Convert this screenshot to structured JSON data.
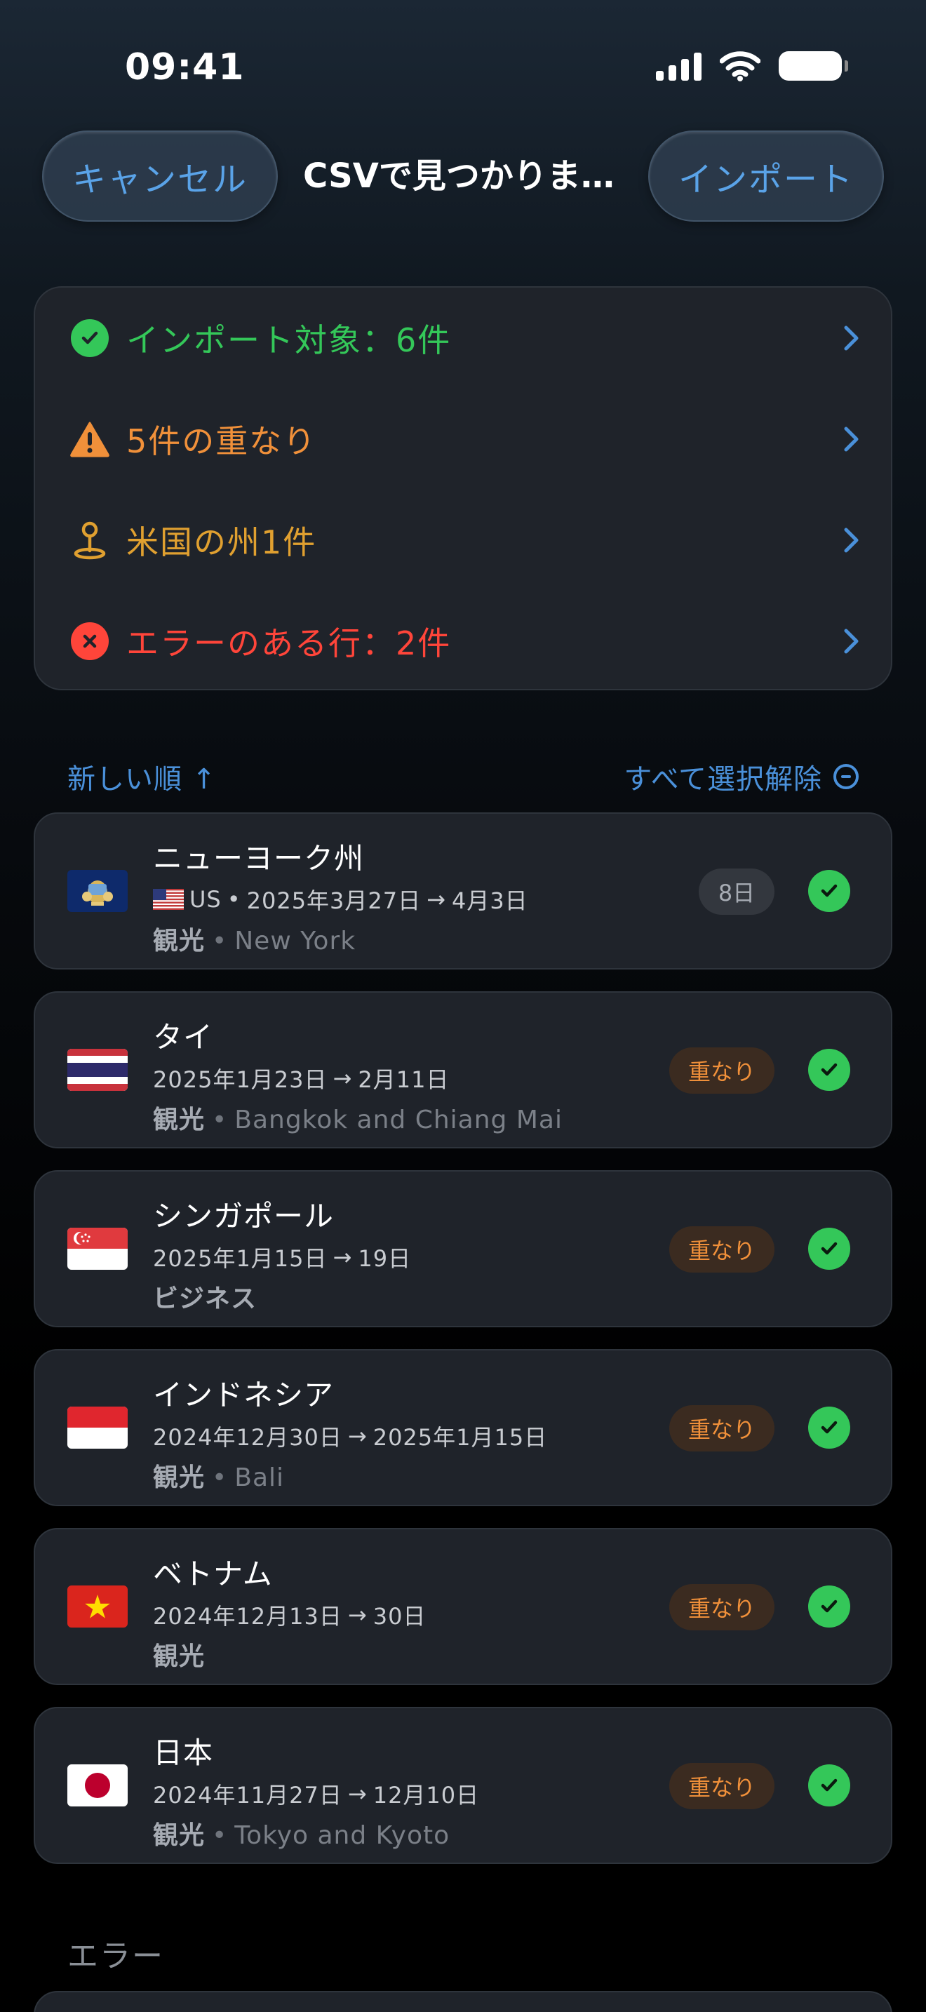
{
  "status_bar": {
    "time": "09:41"
  },
  "nav": {
    "cancel_label": "キャンセル",
    "title": "CSVで見つかりま…",
    "import_label": "インポート"
  },
  "summary": [
    {
      "label": "インポート対象：6件",
      "icon": "check-circle-icon",
      "color": "#34c759"
    },
    {
      "label": "5件の重なり",
      "icon": "warning-triangle-icon",
      "color": "#f0903a"
    },
    {
      "label": "米国の州1件",
      "icon": "map-pin-icon",
      "color": "#e0a030"
    },
    {
      "label": "エラーのある行：2件",
      "icon": "x-circle-icon",
      "color": "#ff453a"
    }
  ],
  "sort": {
    "order_label": "新しい順 ↑",
    "deselect_label": "すべて選択解除"
  },
  "trips": [
    {
      "name": "ニューヨーク州",
      "flag": "new-york",
      "country_code": "US",
      "date_from": "2025年3月27日",
      "date_to": "4月3日",
      "purpose": "観光",
      "location": "New York",
      "badge": "8日",
      "badge_type": "days"
    },
    {
      "name": "タイ",
      "flag": "thailand",
      "date_from": "2025年1月23日",
      "date_to": "2月11日",
      "purpose": "観光",
      "location": "Bangkok and Chiang Mai",
      "badge": "重なり",
      "badge_type": "overlap"
    },
    {
      "name": "シンガポール",
      "flag": "singapore",
      "date_from": "2025年1月15日",
      "date_to": "19日",
      "purpose": "ビジネス",
      "location": "",
      "badge": "重なり",
      "badge_type": "overlap"
    },
    {
      "name": "インドネシア",
      "flag": "indonesia",
      "date_from": "2024年12月30日",
      "date_to": "2025年1月15日",
      "purpose": "観光",
      "location": "Bali",
      "badge": "重なり",
      "badge_type": "overlap"
    },
    {
      "name": "ベトナム",
      "flag": "vietnam",
      "date_from": "2024年12月13日",
      "date_to": "30日",
      "purpose": "観光",
      "location": "",
      "badge": "重なり",
      "badge_type": "overlap"
    },
    {
      "name": "日本",
      "flag": "japan",
      "date_from": "2024年11月27日",
      "date_to": "12月10日",
      "purpose": "観光",
      "location": "Tokyo and Kyoto",
      "badge": "重なり",
      "badge_type": "overlap"
    }
  ],
  "errors_section": {
    "title": "エラー"
  }
}
